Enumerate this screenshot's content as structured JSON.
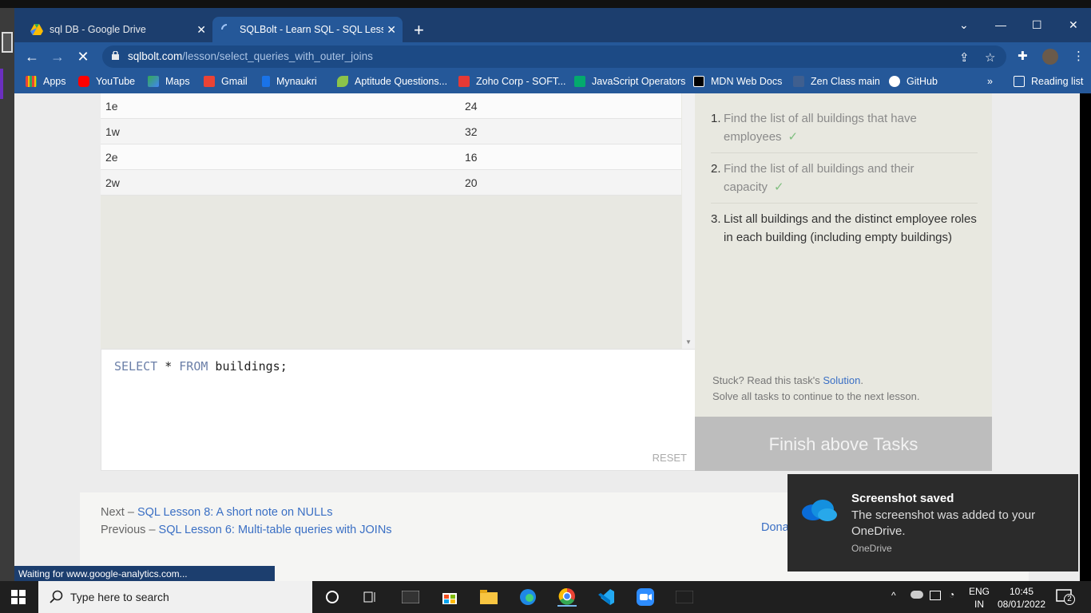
{
  "browser": {
    "tabs": [
      {
        "title": "sql DB - Google Drive",
        "icon": "google-drive-icon"
      },
      {
        "title": "SQLBolt - Learn SQL - SQL Lesso",
        "icon": "loading-spinner-icon"
      }
    ],
    "url_host": "sqlbolt.com",
    "url_path": "/lesson/select_queries_with_outer_joins",
    "bookmarks": [
      {
        "label": "Apps",
        "icon": "apps-grid-icon"
      },
      {
        "label": "YouTube",
        "icon": "youtube-icon"
      },
      {
        "label": "Maps",
        "icon": "maps-icon"
      },
      {
        "label": "Gmail",
        "icon": "gmail-icon"
      },
      {
        "label": "Mynaukri",
        "icon": "mynaukri-icon"
      },
      {
        "label": "Aptitude Questions...",
        "icon": "leaf-icon"
      },
      {
        "label": "Zoho Corp - SOFT...",
        "icon": "zoho-icon"
      },
      {
        "label": "JavaScript Operators",
        "icon": "w3schools-icon"
      },
      {
        "label": "MDN Web Docs",
        "icon": "mdn-icon"
      },
      {
        "label": "Zen Class main",
        "icon": "zen-class-icon"
      },
      {
        "label": "GitHub",
        "icon": "github-icon"
      }
    ],
    "reading_list": "Reading list",
    "status": "Waiting for www.google-analytics.com..."
  },
  "results": {
    "rows": [
      {
        "building": "1e",
        "capacity": "24"
      },
      {
        "building": "1w",
        "capacity": "32"
      },
      {
        "building": "2e",
        "capacity": "16"
      },
      {
        "building": "2w",
        "capacity": "20"
      }
    ]
  },
  "editor": {
    "kw1": "SELECT",
    "star": " * ",
    "kw2": "FROM",
    "table": " buildings;",
    "reset": "RESET"
  },
  "tasks": {
    "items": [
      {
        "num": "1.",
        "text": "Find the list of all buildings that have employees",
        "done": true
      },
      {
        "num": "2.",
        "text": "Find the list of all buildings and their capacity",
        "done": true
      },
      {
        "num": "3.",
        "text": "List all buildings and the distinct employee roles in each building (including empty buildings)",
        "done": false
      }
    ],
    "check": "✓",
    "stuck_prefix": "Stuck? Read this task's ",
    "solution_link": "Solution",
    "stuck_suffix": ".",
    "solve_all": "Solve all tasks to continue to the next lesson.",
    "finish_button": "Finish above Tasks"
  },
  "footer": {
    "next_prefix": "Next – ",
    "next_link": "SQL Lesson 8: A short note on NULLs",
    "prev_prefix": "Previous – ",
    "prev_link": "SQL Lesson 6: Multi-table queries with JOINs",
    "donate": "Dona"
  },
  "toast": {
    "title": "Screenshot saved",
    "body": "The screenshot was added to your OneDrive.",
    "source": "OneDrive"
  },
  "taskbar": {
    "search_placeholder": "Type here to search",
    "lang_line1": "ENG",
    "lang_line2": "IN",
    "time": "10:45",
    "date": "08/01/2022",
    "notifications": "2"
  }
}
